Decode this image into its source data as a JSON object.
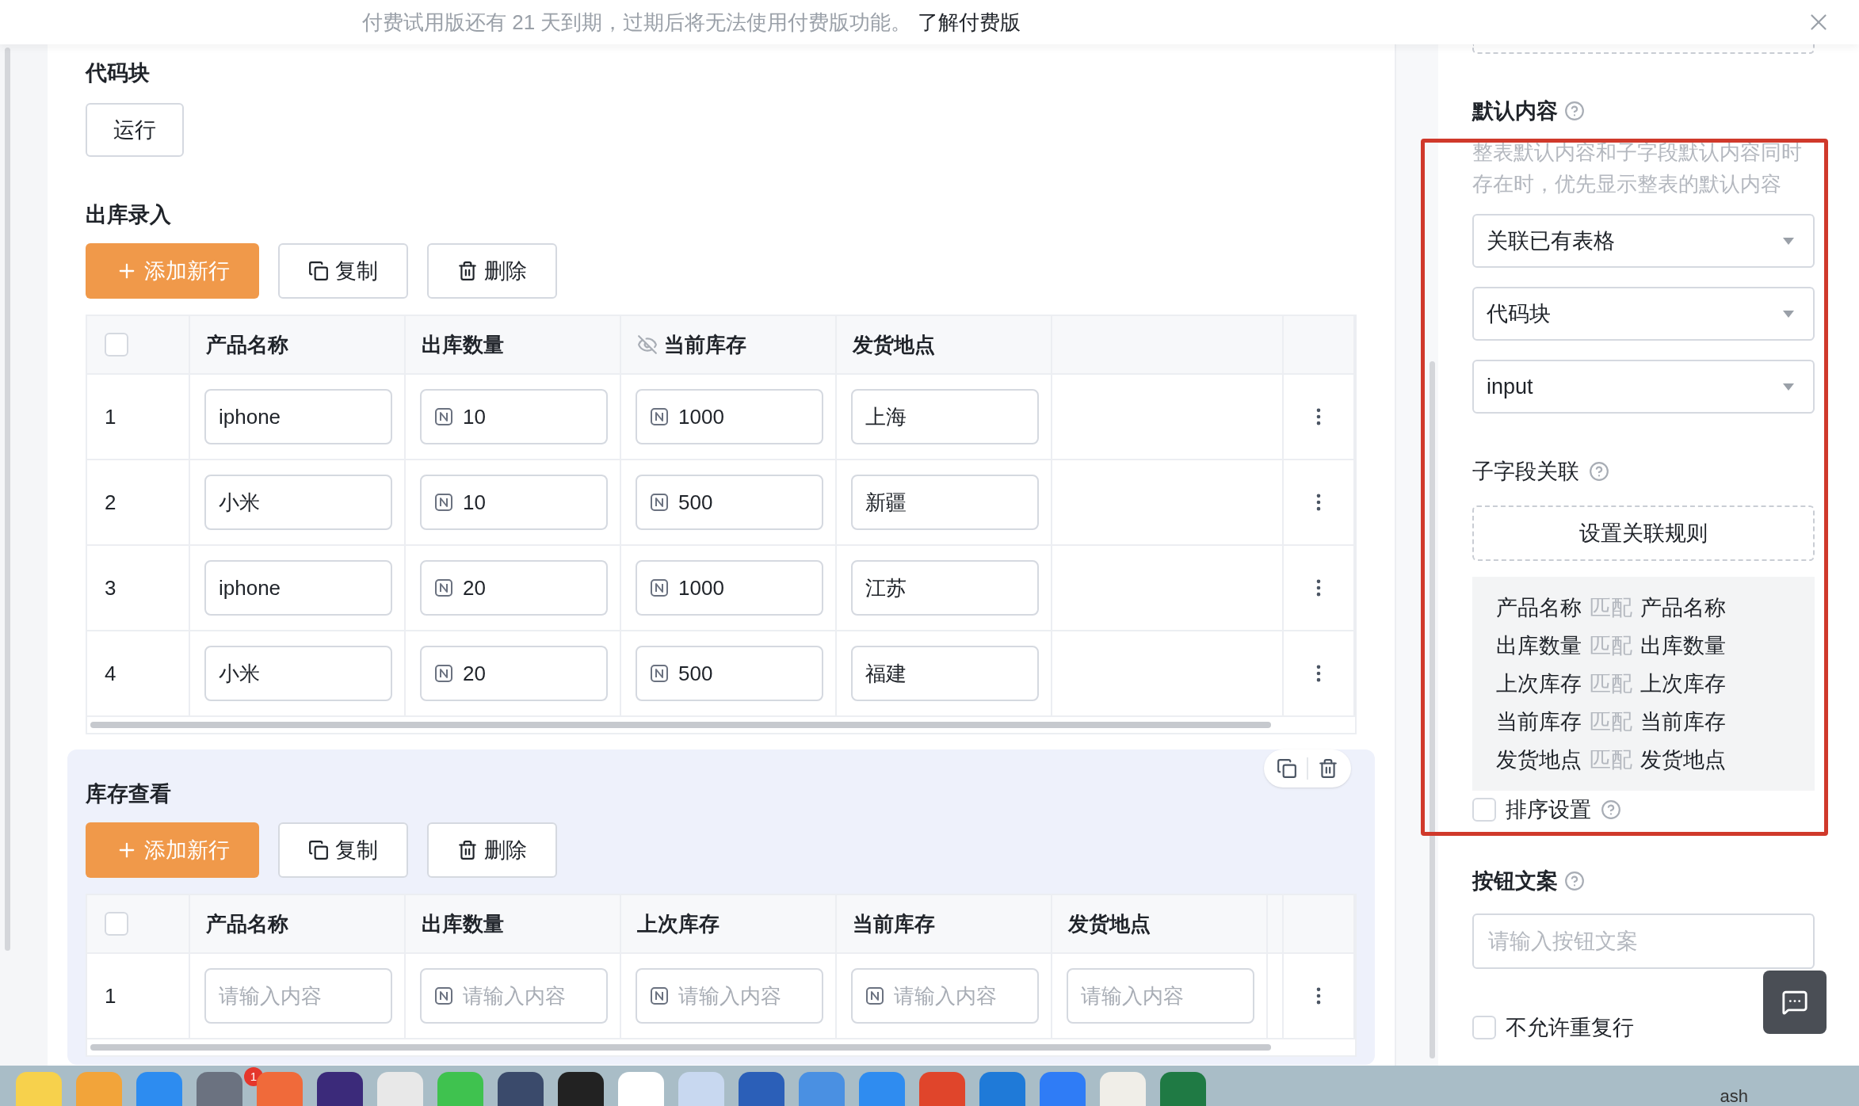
{
  "banner": {
    "message": "付费试用版还有 21 天到期，过期后将无法使用付费版功能。",
    "link": "了解付费版"
  },
  "sections": [
    {
      "kind": "code",
      "title": "代码块",
      "button": "运行"
    },
    {
      "kind": "table",
      "title": "出库录入",
      "highlighted": false,
      "actions": [
        {
          "kind": "add",
          "label": "添加新行"
        },
        {
          "kind": "copy",
          "label": "复制"
        },
        {
          "kind": "delete",
          "label": "删除"
        }
      ],
      "select_all": {
        "checked": false
      },
      "columns": [
        {
          "label": "产品名称",
          "hidden": false
        },
        {
          "label": "出库数量",
          "hidden": false
        },
        {
          "label": "当前库存",
          "hidden": true
        },
        {
          "label": "发货地点",
          "hidden": false
        }
      ],
      "rows": [
        {
          "index": "1",
          "cells": [
            {
              "kind": "text",
              "value": "iphone"
            },
            {
              "kind": "number",
              "value": "10"
            },
            {
              "kind": "number",
              "value": "1000"
            },
            {
              "kind": "text",
              "value": "上海"
            }
          ]
        },
        {
          "index": "2",
          "cells": [
            {
              "kind": "text",
              "value": "小米"
            },
            {
              "kind": "number",
              "value": "10"
            },
            {
              "kind": "number",
              "value": "500"
            },
            {
              "kind": "text",
              "value": "新疆"
            }
          ]
        },
        {
          "index": "3",
          "cells": [
            {
              "kind": "text",
              "value": "iphone"
            },
            {
              "kind": "number",
              "value": "20"
            },
            {
              "kind": "number",
              "value": "1000"
            },
            {
              "kind": "text",
              "value": "江苏"
            }
          ]
        },
        {
          "index": "4",
          "cells": [
            {
              "kind": "text",
              "value": "小米"
            },
            {
              "kind": "number",
              "value": "20"
            },
            {
              "kind": "number",
              "value": "500"
            },
            {
              "kind": "text",
              "value": "福建"
            }
          ]
        }
      ]
    },
    {
      "kind": "table",
      "title": "库存查看",
      "highlighted": true,
      "actions": [
        {
          "kind": "add",
          "label": "添加新行"
        },
        {
          "kind": "copy",
          "label": "复制"
        },
        {
          "kind": "delete",
          "label": "删除"
        }
      ],
      "select_all": {
        "checked": false
      },
      "columns": [
        {
          "label": "产品名称",
          "hidden": false
        },
        {
          "label": "出库数量",
          "hidden": false
        },
        {
          "label": "上次库存",
          "hidden": false
        },
        {
          "label": "当前库存",
          "hidden": false
        },
        {
          "label": "发货地点",
          "hidden": false
        }
      ],
      "rows": [
        {
          "index": "1",
          "cells": [
            {
              "kind": "text",
              "placeholder": "请输入内容"
            },
            {
              "kind": "number",
              "placeholder": "请输入内容"
            },
            {
              "kind": "number",
              "placeholder": "请输入内容"
            },
            {
              "kind": "number",
              "placeholder": "请输入内容"
            },
            {
              "kind": "text",
              "placeholder": "请输入内容"
            }
          ]
        }
      ]
    }
  ],
  "settings": {
    "default_content": {
      "label": "默认内容",
      "hint": "整表默认内容和子字段默认内容同时存在时，优先显示整表的默认内容",
      "selects": [
        "关联已有表格",
        "代码块",
        "input"
      ]
    },
    "subfield": {
      "label": "子字段关联",
      "button": "设置关联规则",
      "mappings": [
        {
          "source": "产品名称",
          "relation": "匹配",
          "target": "产品名称"
        },
        {
          "source": "出库数量",
          "relation": "匹配",
          "target": "出库数量"
        },
        {
          "source": "上次库存",
          "relation": "匹配",
          "target": "上次库存"
        },
        {
          "source": "当前库存",
          "relation": "匹配",
          "target": "当前库存"
        },
        {
          "source": "发货地点",
          "relation": "匹配",
          "target": "发货地点"
        }
      ]
    },
    "sort": {
      "label": "排序设置",
      "checked": false
    },
    "button_text": {
      "label": "按钮文案",
      "placeholder": "请输入按钮文案"
    },
    "no_duplicate": {
      "label": "不允许重复行",
      "checked": false
    }
  },
  "dock": {
    "badge": "1",
    "trash_label": "ash"
  }
}
